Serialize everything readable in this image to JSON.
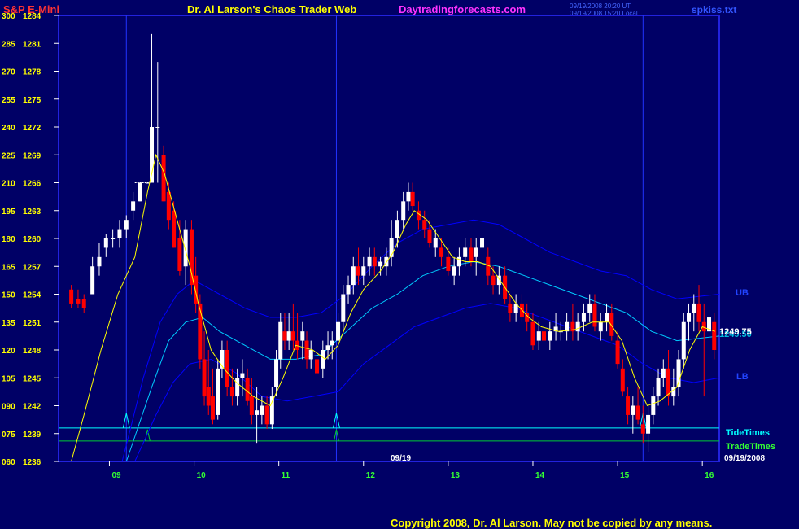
{
  "header": {
    "symbol": "S&P E-Mini",
    "title": "Dr. Al Larson's Chaos Trader Web",
    "site": "Daytradingforecasts.com",
    "ts1": "09/19/2008 20:20 UT",
    "ts2": "09/19/2008 15:20 Local",
    "file": "spkiss.txt"
  },
  "footer": {
    "copyright": "Copyright 2008, Dr. Al Larson. May not be copied by any means."
  },
  "colors": {
    "background": "#000066",
    "frame": "#2222dd",
    "up_bar": "#ffffff",
    "down_bar": "#ff0000",
    "ema": "#ffff00",
    "mid_band": "#00ccff",
    "outer_band": "#0000ff",
    "tide": "#00ffff",
    "trade": "#00cc33"
  },
  "labels": {
    "date_mark": "09/19",
    "date_right": "09/19/2008",
    "tide_times": "TideTimes",
    "trade_times": "TradeTimes",
    "ub": "UB",
    "lb": "LB",
    "last_price": "1249.75",
    "last_price2": "1249.50"
  },
  "chart_data": {
    "type": "candlestick",
    "y_right_ticks": [
      1284,
      1281,
      1278,
      1275,
      1272,
      1269,
      1266,
      1263,
      1260,
      1257,
      1254,
      1251,
      1248,
      1245,
      1242,
      1239,
      1236
    ],
    "y_left_ticks": [
      "300",
      "285",
      "270",
      "255",
      "240",
      "225",
      "210",
      "195",
      "180",
      "165",
      "150",
      "135",
      "120",
      "105",
      "090",
      "075",
      "060"
    ],
    "x_ticks": [
      "09",
      "10",
      "11",
      "12",
      "13",
      "14",
      "15",
      "16"
    ],
    "ylim": [
      1236,
      1284
    ],
    "xlim": [
      8.4,
      16.2
    ],
    "candles": [
      [
        8.55,
        1254.5,
        1255,
        1252.5,
        1253
      ],
      [
        8.63,
        1253.5,
        1254.5,
        1252.5,
        1253
      ],
      [
        8.7,
        1253.5,
        1254,
        1252,
        1252.5
      ],
      [
        8.8,
        1254,
        1258,
        1254,
        1257
      ],
      [
        8.88,
        1257,
        1259.5,
        1256,
        1258
      ],
      [
        8.96,
        1259,
        1260.5,
        1258,
        1260
      ],
      [
        9.04,
        1260,
        1261,
        1259,
        1260
      ],
      [
        9.12,
        1260,
        1262,
        1259,
        1261
      ],
      [
        9.2,
        1261,
        1262.5,
        1260,
        1262
      ],
      [
        9.28,
        1263,
        1265,
        1262,
        1264
      ],
      [
        9.36,
        1264,
        1266,
        1264,
        1266
      ],
      [
        9.45,
        1266,
        1266,
        1266,
        1266
      ],
      [
        9.5,
        1266,
        1282,
        1266,
        1272
      ],
      [
        9.57,
        1272,
        1279,
        1266,
        1272
      ],
      [
        9.64,
        1269,
        1270,
        1264,
        1264
      ],
      [
        9.7,
        1265,
        1266,
        1261,
        1262
      ],
      [
        9.76,
        1263,
        1264,
        1259,
        1259
      ],
      [
        9.83,
        1260,
        1262,
        1256,
        1256.5
      ],
      [
        9.9,
        1257,
        1262,
        1255,
        1261
      ],
      [
        9.97,
        1261,
        1262,
        1254,
        1255
      ],
      [
        10.02,
        1256,
        1258,
        1252,
        1253
      ],
      [
        10.07,
        1253,
        1254,
        1246,
        1247
      ],
      [
        10.12,
        1247,
        1250,
        1242,
        1243
      ],
      [
        10.17,
        1244,
        1248,
        1241,
        1242
      ],
      [
        10.22,
        1243,
        1246,
        1240,
        1240.5
      ],
      [
        10.28,
        1241,
        1247,
        1240.5,
        1246
      ],
      [
        10.33,
        1246,
        1249,
        1245,
        1248
      ],
      [
        10.39,
        1248,
        1249,
        1243,
        1244
      ],
      [
        10.45,
        1244,
        1246,
        1242,
        1243
      ],
      [
        10.51,
        1243,
        1246,
        1242,
        1245
      ],
      [
        10.57,
        1245,
        1247,
        1243,
        1245.5
      ],
      [
        10.63,
        1245,
        1246,
        1242,
        1242.5
      ],
      [
        10.68,
        1243,
        1245,
        1240,
        1241
      ],
      [
        10.74,
        1241,
        1244,
        1238,
        1241.5
      ],
      [
        10.8,
        1241,
        1243,
        1240,
        1242
      ],
      [
        10.86,
        1242,
        1243,
        1239.5,
        1240
      ],
      [
        10.92,
        1240,
        1244,
        1239.5,
        1243
      ],
      [
        10.97,
        1244,
        1248,
        1243,
        1247
      ],
      [
        11.02,
        1247,
        1252,
        1246,
        1251
      ],
      [
        11.07,
        1250,
        1252,
        1248,
        1249
      ],
      [
        11.12,
        1249,
        1252,
        1248,
        1250
      ],
      [
        11.17,
        1250,
        1253,
        1248,
        1249
      ],
      [
        11.22,
        1249,
        1252,
        1247,
        1248
      ],
      [
        11.28,
        1249,
        1251,
        1247,
        1250
      ],
      [
        11.33,
        1249,
        1250,
        1246,
        1247
      ],
      [
        11.38,
        1247,
        1249,
        1246,
        1248
      ],
      [
        11.45,
        1247,
        1249,
        1245,
        1245.5
      ],
      [
        11.52,
        1246,
        1249,
        1245,
        1248
      ],
      [
        11.58,
        1248,
        1250,
        1247,
        1248.5
      ],
      [
        11.63,
        1248.5,
        1250,
        1247,
        1249
      ],
      [
        11.7,
        1249,
        1252,
        1248,
        1251
      ],
      [
        11.76,
        1251,
        1255,
        1250,
        1254
      ],
      [
        11.82,
        1254,
        1256,
        1253,
        1255
      ],
      [
        11.88,
        1255,
        1258,
        1254,
        1257
      ],
      [
        11.94,
        1257,
        1259,
        1255,
        1256
      ],
      [
        12,
        1256,
        1258,
        1255,
        1257
      ],
      [
        12.07,
        1257,
        1259,
        1256,
        1258
      ],
      [
        12.13,
        1258,
        1259,
        1256,
        1257
      ],
      [
        12.2,
        1257,
        1258,
        1256,
        1257.5
      ],
      [
        12.27,
        1257,
        1259,
        1256,
        1258
      ],
      [
        12.33,
        1258,
        1262,
        1257,
        1260
      ],
      [
        12.4,
        1260,
        1263,
        1259,
        1262
      ],
      [
        12.47,
        1262,
        1265,
        1261,
        1264
      ],
      [
        12.53,
        1264,
        1266,
        1263,
        1265
      ],
      [
        12.58,
        1265,
        1266,
        1263,
        1263.5
      ],
      [
        12.65,
        1263,
        1264,
        1261,
        1262
      ],
      [
        12.72,
        1262,
        1263,
        1260,
        1261
      ],
      [
        12.78,
        1261,
        1262,
        1259,
        1259.5
      ],
      [
        12.85,
        1259,
        1261,
        1258,
        1260
      ],
      [
        12.92,
        1259,
        1260,
        1257,
        1258
      ],
      [
        13,
        1258,
        1259,
        1256,
        1256.5
      ],
      [
        13.07,
        1256,
        1258,
        1255,
        1257
      ],
      [
        13.13,
        1257,
        1259,
        1256,
        1258
      ],
      [
        13.2,
        1258,
        1260,
        1257,
        1259
      ],
      [
        13.27,
        1259,
        1260,
        1257,
        1257.5
      ],
      [
        13.33,
        1258,
        1260,
        1256,
        1259
      ],
      [
        13.4,
        1259,
        1261,
        1258,
        1260
      ],
      [
        13.47,
        1258,
        1259,
        1255,
        1256
      ],
      [
        13.53,
        1256,
        1257,
        1254,
        1255
      ],
      [
        13.6,
        1255,
        1257,
        1254,
        1256
      ],
      [
        13.67,
        1256,
        1257,
        1253,
        1253.5
      ],
      [
        13.73,
        1253,
        1254,
        1251,
        1252
      ],
      [
        13.8,
        1252,
        1254,
        1251,
        1253
      ],
      [
        13.87,
        1253,
        1254,
        1251,
        1251.5
      ],
      [
        13.93,
        1252,
        1253,
        1250,
        1251
      ],
      [
        14,
        1251,
        1252,
        1248,
        1248.5
      ],
      [
        14.07,
        1249,
        1251,
        1248,
        1250
      ],
      [
        14.13,
        1250,
        1251,
        1248,
        1249
      ],
      [
        14.2,
        1249,
        1251,
        1248,
        1250
      ],
      [
        14.27,
        1250,
        1252,
        1249,
        1250.5
      ],
      [
        14.33,
        1250,
        1251,
        1249,
        1250
      ],
      [
        14.4,
        1250,
        1252,
        1249,
        1251
      ],
      [
        14.47,
        1251,
        1253,
        1249,
        1250
      ],
      [
        14.53,
        1250,
        1252,
        1249,
        1251
      ],
      [
        14.6,
        1251,
        1253,
        1250,
        1252
      ],
      [
        14.67,
        1252,
        1254,
        1251,
        1253
      ],
      [
        14.73,
        1253,
        1254,
        1250,
        1250.5
      ],
      [
        14.8,
        1250,
        1252,
        1249,
        1251
      ],
      [
        14.87,
        1251,
        1253,
        1250,
        1252
      ],
      [
        14.93,
        1252,
        1253,
        1249,
        1249.5
      ],
      [
        15,
        1249,
        1250,
        1246,
        1246.5
      ],
      [
        15.06,
        1246,
        1247,
        1243,
        1243.5
      ],
      [
        15.12,
        1243,
        1244,
        1240,
        1241
      ],
      [
        15.18,
        1241,
        1243,
        1239,
        1242
      ],
      [
        15.24,
        1242,
        1244,
        1240,
        1240.5
      ],
      [
        15.3,
        1240,
        1242,
        1238,
        1239
      ],
      [
        15.36,
        1239,
        1242,
        1237,
        1241
      ],
      [
        15.42,
        1241,
        1244,
        1240,
        1243
      ],
      [
        15.48,
        1243,
        1246,
        1242,
        1245
      ],
      [
        15.54,
        1245,
        1247,
        1244,
        1246
      ],
      [
        15.6,
        1246,
        1248,
        1242,
        1243
      ],
      [
        15.66,
        1243,
        1246,
        1242,
        1244
      ],
      [
        15.72,
        1244,
        1248,
        1243,
        1247
      ],
      [
        15.78,
        1247,
        1252,
        1246,
        1251
      ],
      [
        15.84,
        1251,
        1253,
        1249,
        1252
      ],
      [
        15.9,
        1252,
        1254,
        1250,
        1253
      ],
      [
        15.96,
        1253,
        1255,
        1250,
        1251
      ],
      [
        16.02,
        1251,
        1253,
        1243,
        1250
      ],
      [
        16.08,
        1250,
        1252,
        1249,
        1251.5
      ],
      [
        16.14,
        1251,
        1252,
        1247,
        1248
      ]
    ],
    "ema": [
      [
        8.55,
        1236
      ],
      [
        8.7,
        1241
      ],
      [
        8.9,
        1248
      ],
      [
        9.1,
        1254
      ],
      [
        9.3,
        1258
      ],
      [
        9.45,
        1265
      ],
      [
        9.55,
        1269
      ],
      [
        9.65,
        1267
      ],
      [
        9.8,
        1262
      ],
      [
        9.95,
        1257
      ],
      [
        10.05,
        1253
      ],
      [
        10.2,
        1248
      ],
      [
        10.35,
        1246
      ],
      [
        10.5,
        1244.5
      ],
      [
        10.7,
        1243
      ],
      [
        10.9,
        1242
      ],
      [
        11.05,
        1245
      ],
      [
        11.2,
        1248.5
      ],
      [
        11.4,
        1248
      ],
      [
        11.55,
        1247
      ],
      [
        11.7,
        1248.5
      ],
      [
        11.85,
        1252
      ],
      [
        12,
        1254.5
      ],
      [
        12.2,
        1256.5
      ],
      [
        12.35,
        1258.5
      ],
      [
        12.5,
        1261.5
      ],
      [
        12.6,
        1263
      ],
      [
        12.75,
        1262
      ],
      [
        12.9,
        1260
      ],
      [
        13.05,
        1258
      ],
      [
        13.2,
        1257.5
      ],
      [
        13.35,
        1257.5
      ],
      [
        13.5,
        1257
      ],
      [
        13.65,
        1255
      ],
      [
        13.8,
        1253
      ],
      [
        13.95,
        1251.5
      ],
      [
        14.1,
        1250.5
      ],
      [
        14.3,
        1250
      ],
      [
        14.5,
        1250.2
      ],
      [
        14.7,
        1251
      ],
      [
        14.9,
        1251
      ],
      [
        15.05,
        1249
      ],
      [
        15.2,
        1245
      ],
      [
        15.35,
        1242
      ],
      [
        15.5,
        1242.5
      ],
      [
        15.7,
        1244
      ],
      [
        15.85,
        1248
      ],
      [
        16,
        1250.5
      ],
      [
        16.15,
        1250
      ]
    ],
    "mid_band": [
      [
        9.2,
        1236
      ],
      [
        9.5,
        1244
      ],
      [
        9.7,
        1249
      ],
      [
        9.9,
        1251
      ],
      [
        10.1,
        1251.5
      ],
      [
        10.3,
        1250
      ],
      [
        10.6,
        1248.5
      ],
      [
        10.9,
        1247
      ],
      [
        11.2,
        1247
      ],
      [
        11.5,
        1247.5
      ],
      [
        11.8,
        1250
      ],
      [
        12.1,
        1252.5
      ],
      [
        12.4,
        1254
      ],
      [
        12.7,
        1256
      ],
      [
        13,
        1257
      ],
      [
        13.3,
        1257.5
      ],
      [
        13.6,
        1257
      ],
      [
        13.9,
        1256
      ],
      [
        14.2,
        1255
      ],
      [
        14.5,
        1254
      ],
      [
        14.8,
        1253
      ],
      [
        15.1,
        1252
      ],
      [
        15.4,
        1250
      ],
      [
        15.7,
        1249
      ],
      [
        16,
        1249.3
      ],
      [
        16.2,
        1249.5
      ]
    ],
    "upper_band": [
      [
        9.15,
        1236
      ],
      [
        9.4,
        1245
      ],
      [
        9.6,
        1251
      ],
      [
        9.8,
        1254
      ],
      [
        10.0,
        1255.5
      ],
      [
        10.3,
        1254
      ],
      [
        10.6,
        1252.5
      ],
      [
        10.9,
        1251.5
      ],
      [
        11.2,
        1251.5
      ],
      [
        11.5,
        1252
      ],
      [
        11.8,
        1254
      ],
      [
        12.1,
        1257
      ],
      [
        12.4,
        1259.5
      ],
      [
        12.7,
        1261
      ],
      [
        13,
        1261.5
      ],
      [
        13.3,
        1262
      ],
      [
        13.6,
        1261.5
      ],
      [
        13.9,
        1260
      ],
      [
        14.2,
        1258.5
      ],
      [
        14.5,
        1257.5
      ],
      [
        14.8,
        1256.5
      ],
      [
        15.1,
        1256
      ],
      [
        15.4,
        1254.5
      ],
      [
        15.7,
        1253.5
      ],
      [
        16,
        1253.8
      ],
      [
        16.2,
        1254
      ]
    ],
    "lower_band": [
      [
        9.3,
        1236
      ],
      [
        9.55,
        1241
      ],
      [
        9.75,
        1244.5
      ],
      [
        9.95,
        1246.5
      ],
      [
        10.2,
        1247
      ],
      [
        10.5,
        1245.5
      ],
      [
        10.8,
        1243
      ],
      [
        11.1,
        1242.5
      ],
      [
        11.4,
        1243
      ],
      [
        11.7,
        1243.5
      ],
      [
        12.0,
        1246.5
      ],
      [
        12.3,
        1248.5
      ],
      [
        12.6,
        1250.5
      ],
      [
        12.9,
        1251.5
      ],
      [
        13.2,
        1252.5
      ],
      [
        13.5,
        1253
      ],
      [
        13.8,
        1252.5
      ],
      [
        14.1,
        1251.5
      ],
      [
        14.4,
        1250.5
      ],
      [
        14.7,
        1249.5
      ],
      [
        15.0,
        1248.5
      ],
      [
        15.3,
        1246.5
      ],
      [
        15.6,
        1245
      ],
      [
        15.9,
        1244.5
      ],
      [
        16.2,
        1245
      ]
    ],
    "vlines": [
      9.2,
      11.68,
      15.3
    ],
    "tide_level": 1239.6,
    "trade_level": 1238.2,
    "tide_spikes": [
      9.2,
      11.68,
      15.3
    ],
    "trade_spikes": [
      9.45,
      11.68
    ]
  }
}
